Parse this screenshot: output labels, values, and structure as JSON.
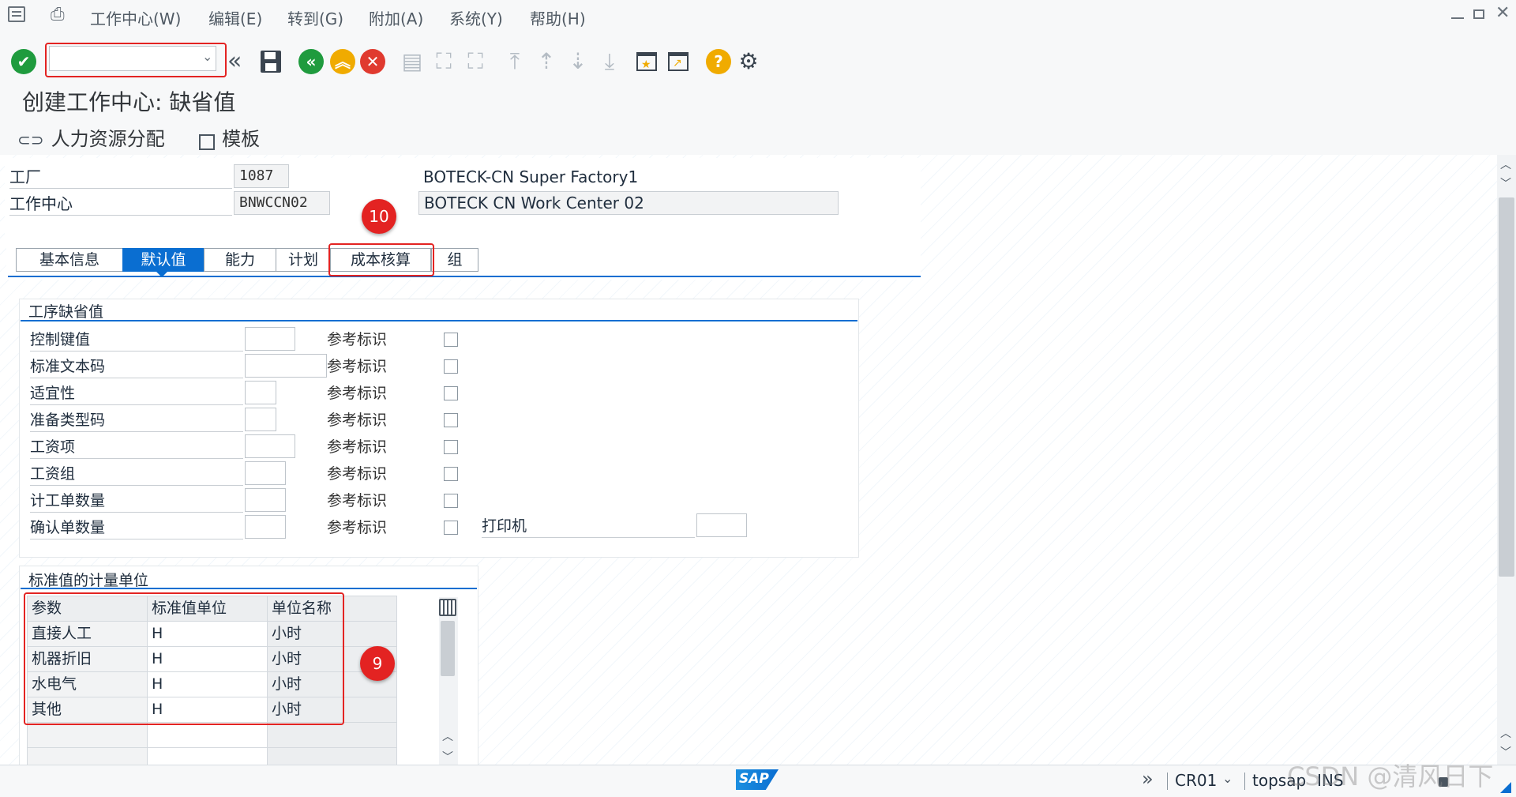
{
  "menu": {
    "items": [
      "工作中心(W)",
      "编辑(E)",
      "转到(G)",
      "附加(A)",
      "系统(Y)",
      "帮助(H)"
    ]
  },
  "toolbar": {
    "command_field_value": "",
    "icons": [
      "enter-check-icon",
      "double-left-icon",
      "save-icon",
      "back-icon",
      "exit-icon",
      "cancel-icon",
      "print-icon",
      "find-icon",
      "find-next-icon",
      "first-page-icon",
      "prev-page-icon",
      "next-page-icon",
      "last-page-icon",
      "create-session-icon",
      "shortcut-icon",
      "help-icon",
      "settings-gear-icon"
    ]
  },
  "page_title": "创建工作中心: 缺省值",
  "app_toolbar": {
    "hr_assign_label": "人力资源分配",
    "template_label": "模板"
  },
  "header": {
    "plant_label": "工厂",
    "plant_value": "1087",
    "plant_desc": "BOTECK-CN Super Factory1",
    "wc_label": "工作中心",
    "wc_value": "BNWCCN02",
    "wc_desc": "BOTECK CN Work Center 02"
  },
  "tabs": [
    {
      "label": "基本信息",
      "active": false
    },
    {
      "label": "默认值",
      "active": true
    },
    {
      "label": "能力",
      "active": false
    },
    {
      "label": "计划",
      "active": false
    },
    {
      "label": "成本核算",
      "active": false
    },
    {
      "label": "组",
      "active": false
    }
  ],
  "defaults_group": {
    "title": "工序缺省值",
    "ref_label": "参考标识",
    "rows": [
      {
        "label": "控制键值"
      },
      {
        "label": "标准文本码"
      },
      {
        "label": "适宜性"
      },
      {
        "label": "准备类型码"
      },
      {
        "label": "工资项"
      },
      {
        "label": "工资组"
      },
      {
        "label": "计工单数量"
      },
      {
        "label": "确认单数量"
      }
    ],
    "printer_label": "打印机"
  },
  "units_group": {
    "title": "标准值的计量单位",
    "columns": [
      "参数",
      "标准值单位",
      "单位名称"
    ],
    "rows": [
      [
        "直接人工",
        "H",
        "小时"
      ],
      [
        "机器折旧",
        "H",
        "小时"
      ],
      [
        "水电气",
        "H",
        "小时"
      ],
      [
        "其他",
        "H",
        "小时"
      ]
    ]
  },
  "callouts": {
    "tab_marker": "10",
    "table_marker": "9"
  },
  "status": {
    "system": "CR01",
    "server": "topsap",
    "mode": "INS",
    "watermark": "CSDN @清风日下",
    "logo": "SAP"
  },
  "colors": {
    "accent": "#0a6ed1",
    "callout": "#e32322",
    "confirm": "#1f9b3e",
    "cancel": "#e03a2f",
    "help": "#f0ab00"
  }
}
